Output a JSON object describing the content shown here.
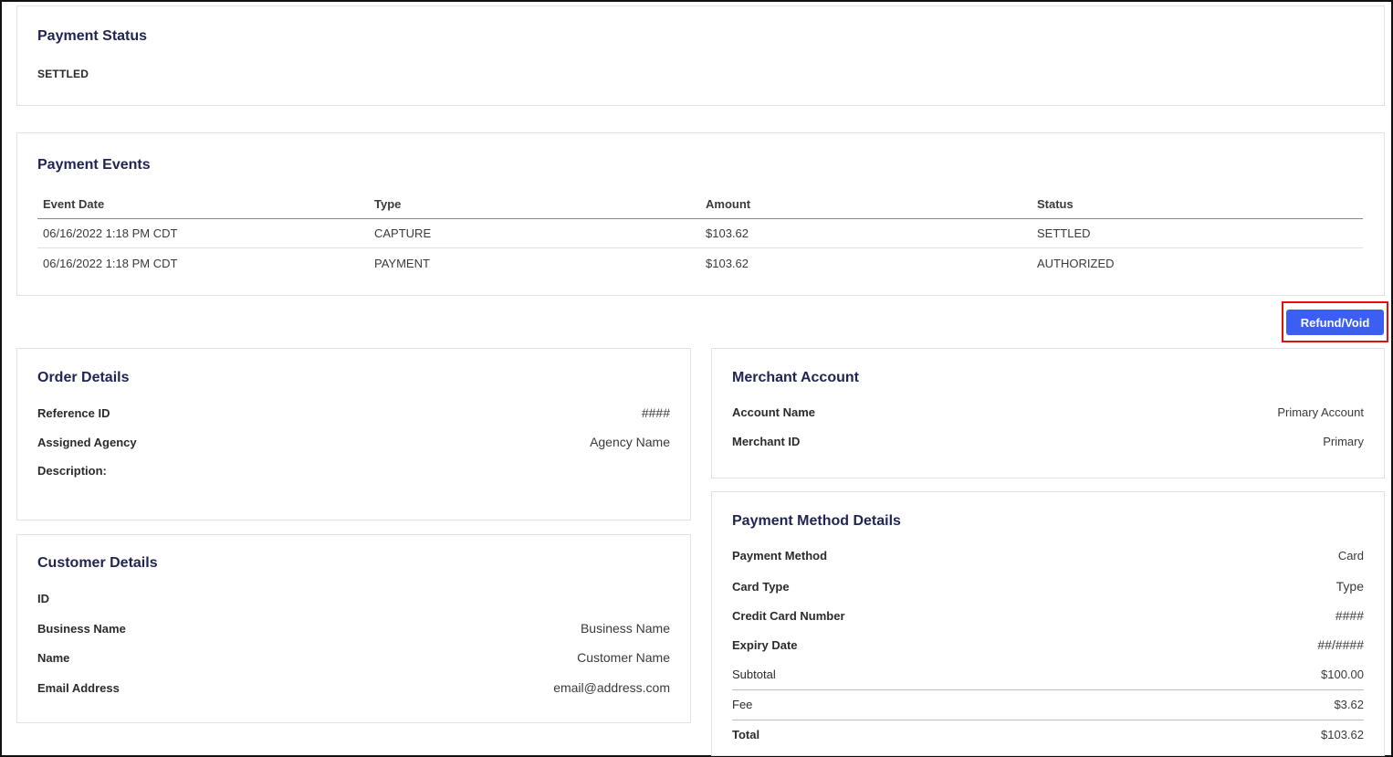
{
  "payment_status": {
    "title": "Payment Status",
    "value": "SETTLED"
  },
  "payment_events": {
    "title": "Payment Events",
    "columns": [
      "Event Date",
      "Type",
      "Amount",
      "Status"
    ],
    "rows": [
      [
        "06/16/2022 1:18 PM CDT",
        "CAPTURE",
        "$103.62",
        "SETTLED"
      ],
      [
        "06/16/2022 1:18 PM CDT",
        "PAYMENT",
        "$103.62",
        "AUTHORIZED"
      ]
    ]
  },
  "actions": {
    "refund_label": "Refund/Void"
  },
  "order_details": {
    "title": "Order Details",
    "reference_id_label": "Reference ID",
    "reference_id_value": "####",
    "assigned_agency_label": "Assigned Agency",
    "assigned_agency_value": "Agency Name",
    "description_label": "Description:"
  },
  "customer_details": {
    "title": "Customer Details",
    "id_label": "ID",
    "business_name_label": "Business Name",
    "business_name_value": "Business Name",
    "name_label": "Name",
    "name_value": "Customer Name",
    "email_label": "Email Address",
    "email_value": "email@address.com"
  },
  "merchant_account": {
    "title": "Merchant Account",
    "account_name_label": "Account Name",
    "account_name_value": "Primary Account",
    "merchant_id_label": "Merchant ID",
    "merchant_id_value": "Primary"
  },
  "payment_method_details": {
    "title": "Payment Method Details",
    "payment_method_label": "Payment Method",
    "payment_method_value": "Card",
    "card_type_label": "Card Type",
    "card_type_value": "Type",
    "card_number_label": "Credit Card Number",
    "card_number_value": "####",
    "expiry_label": "Expiry Date",
    "expiry_value": "##/####",
    "subtotal_label": "Subtotal",
    "subtotal_value": "$100.00",
    "fee_label": "Fee",
    "fee_value": "$3.62",
    "total_label": "Total",
    "total_value": "$103.62"
  },
  "colors": {
    "title_text": "#1f2452",
    "button_bg": "#3a5ff2",
    "highlight_border": "#e01010"
  }
}
